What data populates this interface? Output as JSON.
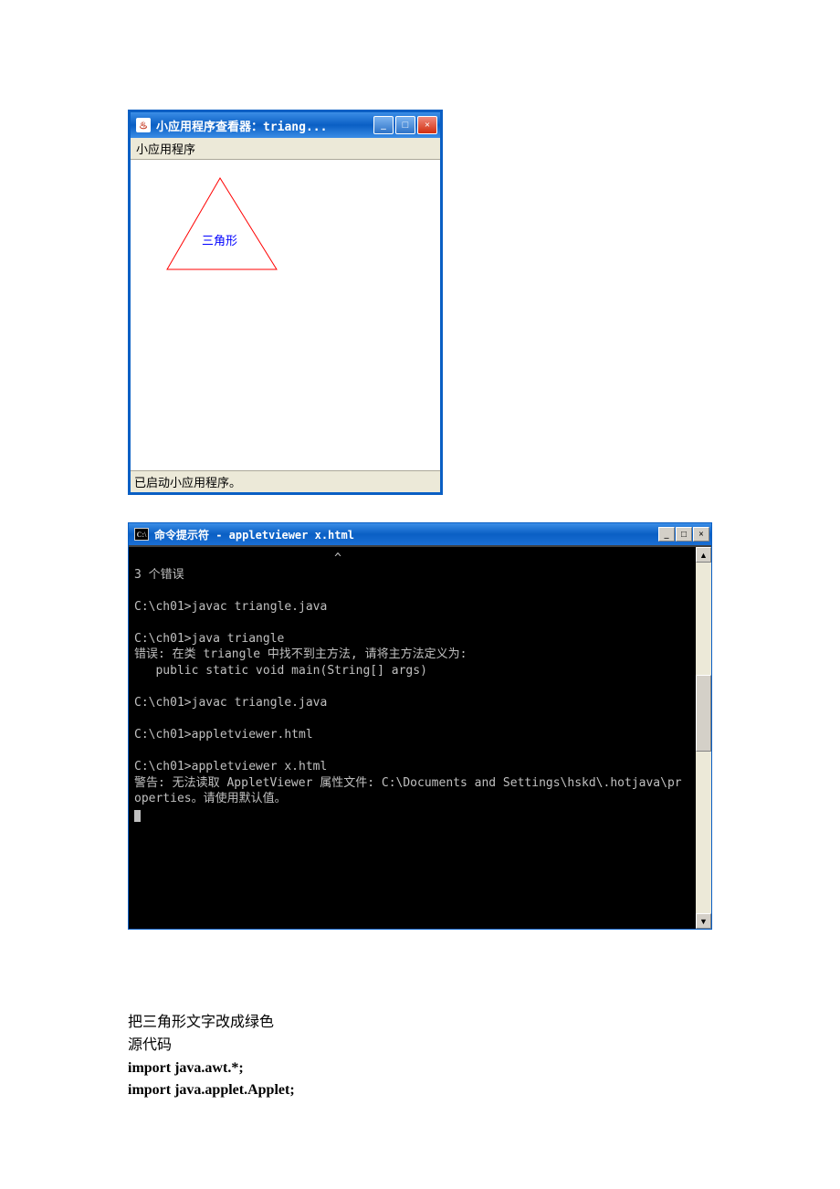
{
  "applet": {
    "title": "小应用程序查看器：triang...",
    "menu": "小应用程序",
    "triangle_label": "三角形",
    "status": "已启动小应用程序。",
    "colors": {
      "triangle_stroke": "#ff0000",
      "label_color": "#0000ff"
    }
  },
  "cmd": {
    "title": "命令提示符 - appletviewer x.html",
    "icon": "C:\\",
    "lines": "                            ^\n3 个错误\n\nC:\\ch01>javac triangle.java\n\nC:\\ch01>java triangle\n错误: 在类 triangle 中找不到主方法, 请将主方法定义为:\n   public static void main(String[] args)\n\nC:\\ch01>javac triangle.java\n\nC:\\ch01>appletviewer.html\n\nC:\\ch01>appletviewer x.html\n警告: 无法读取 AppletViewer 属性文件: C:\\Documents and Settings\\hskd\\.hotjava\\pr\noperties。请使用默认值。\n"
  },
  "doc": {
    "line1": "把三角形文字改成绿色",
    "line2": "源代码",
    "code1": "import java.awt.*;",
    "code2": "import java.applet.Applet;"
  },
  "icons": {
    "minimize": "_",
    "maximize": "□",
    "close": "×",
    "up": "▲",
    "down": "▼",
    "java": "♨"
  }
}
